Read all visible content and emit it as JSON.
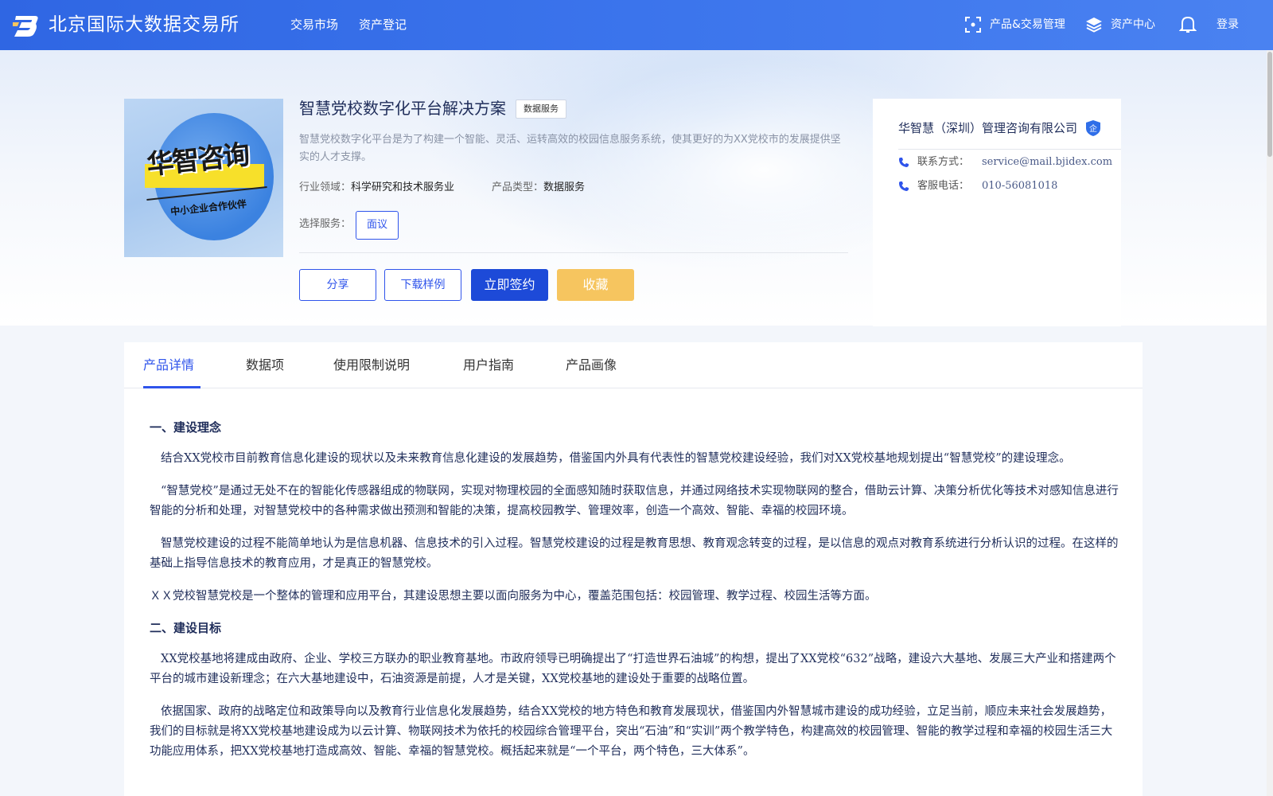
{
  "header": {
    "site_name": "北京国际大数据交易所",
    "nav": [
      "交易市场",
      "资产登记"
    ],
    "product_mgmt": "产品&交易管理",
    "asset_center": "资产中心",
    "login": "登录"
  },
  "product": {
    "title": "智慧党校数字化平台解决方案",
    "tag": "数据服务",
    "description": "智慧党校数字化平台是为了构建一个智能、灵活、运转高效的校园信息服务系统，使其更好的为XX党校市的发展提供坚实的人才支撑。",
    "industry_label": "行业领域：",
    "industry_value": "科学研究和技术服务业",
    "type_label": "产品类型：",
    "type_value": "数据服务",
    "service_label": "选择服务：",
    "service_option": "面议",
    "image_brand": "华智咨询",
    "image_sub": "中小企业合作伙伴"
  },
  "actions": {
    "share": "分享",
    "download": "下载样例",
    "sign": "立即签约",
    "favorite": "收藏"
  },
  "company": {
    "name": "华智慧（深圳）管理咨询有限公司",
    "badge": "企",
    "contact_label": "联系方式：",
    "contact_value": "service@mail.bjidex.com",
    "phone_label": "客服电话：",
    "phone_value": "010-56081018"
  },
  "tabs": [
    "产品详情",
    "数据项",
    "使用限制说明",
    "用户指南",
    "产品画像"
  ],
  "active_tab": "产品详情",
  "article": {
    "h1": "一、建设理念",
    "p1": "结合XX党校市目前教育信息化建设的现状以及未来教育信息化建设的发展趋势，借鉴国内外具有代表性的智慧党校建设经验，我们对XX党校基地规划提出“智慧党校”的建设理念。",
    "p2": "“智慧党校”是通过无处不在的智能化传感器组成的物联网，实现对物理校园的全面感知随时获取信息，并通过网络技术实现物联网的整合，借助云计算、决策分析优化等技术对感知信息进行智能的分析和处理，对智慧党校中的各种需求做出预测和智能的决策，提高校园教学、管理效率，创造一个高效、智能、幸福的校园环境。",
    "p3": "智慧党校建设的过程不能简单地认为是信息机器、信息技术的引入过程。智慧党校建设的过程是教育思想、教育观念转变的过程，是以信息的观点对教育系统进行分析认识的过程。在这样的基础上指导信息技术的教育应用，才是真正的智慧党校。",
    "p4": "ＸＸ党校智慧党校是一个整体的管理和应用平台，其建设思想主要以面向服务为中心，覆盖范围包括：校园管理、教学过程、校园生活等方面。",
    "h2": "二、建设目标",
    "p5": "XX党校基地将建成由政府、企业、学校三方联办的职业教育基地。市政府领导已明确提出了“打造世界石油城”的构想，提出了XX党校“632”战略，建设六大基地、发展三大产业和搭建两个平台的城市建设新理念；在六大基地建设中，石油资源是前提，人才是关键，XX党校基地的建设处于重要的战略位置。",
    "p6": "依据国家、政府的战略定位和政策导向以及教育行业信息化发展趋势，结合XX党校的地方特色和教育发展现状，借鉴国内外智慧城市建设的成功经验，立足当前，顺应未来社会发展趋势，我们的目标就是将XX党校基地建设成为以云计算、物联网技术为依托的校园综合管理平台，突出“石油”和“实训”两个教学特色，构建高效的校园管理、智能的教学过程和幸福的校园生活三大功能应用体系，把XX党校基地打造成高效、智能、幸福的智慧党校。概括起来就是“一个平台，两个特色，三大体系”。"
  },
  "colors": {
    "header_blue": "#3b74ec",
    "primary": "#2f54eb",
    "sign_button": "#1d4ad8",
    "favorite_button": "#f6c55f"
  }
}
